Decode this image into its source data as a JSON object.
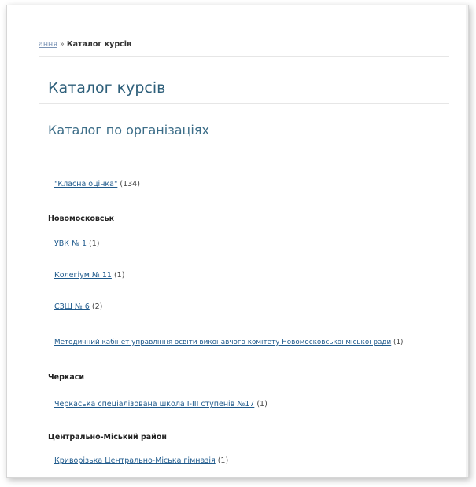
{
  "breadcrumb": {
    "link": "ання",
    "separator": "»",
    "current": "Каталог курсів"
  },
  "page_title": "Каталог курсів",
  "section_title": "Каталог по організаціях",
  "items": [
    {
      "name": "\"Класна оцінка\"",
      "count": "(134)"
    },
    {
      "group": "Новомосковськ"
    },
    {
      "name": "УВК № 1",
      "count": "(1)"
    },
    {
      "name": "Колегіум № 11",
      "count": "(1)"
    },
    {
      "name": "СЗШ № 6",
      "count": "(2)"
    },
    {
      "name": "Методичний кабінет управління освіти виконавчого комітету Новомосковської міської ради",
      "count": "(1)"
    },
    {
      "group": "Черкаси"
    },
    {
      "name": "Черкаська спеціалізована школа І-ІІІ ступенів №17",
      "count": "(1)"
    },
    {
      "group": "Центрально-Міський район"
    },
    {
      "name": "Криворізька Центрально-Міська гімназія",
      "count": "(1)"
    }
  ]
}
